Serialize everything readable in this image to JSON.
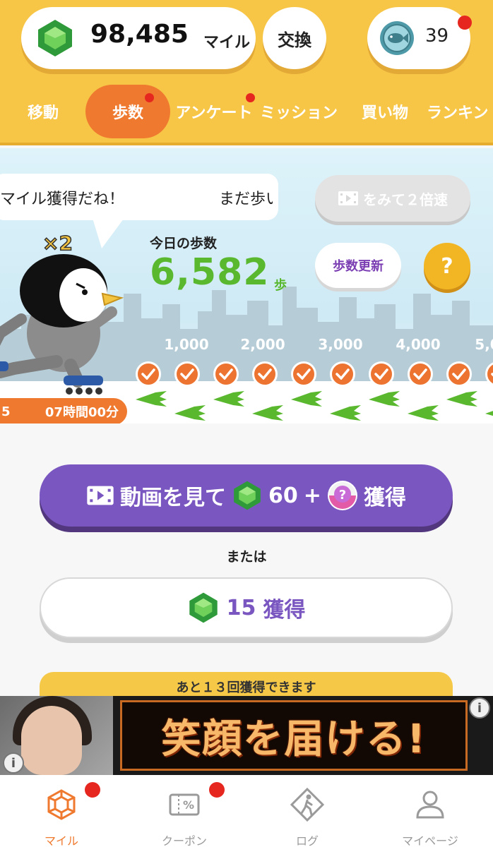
{
  "colors": {
    "header_bg": "#f8c647",
    "accent_orange": "#ef7a2f",
    "purple": "#7a56c0",
    "step_green": "#5ab82f",
    "badge_red": "#e6271f"
  },
  "header": {
    "miles_icon": "green-gem-icon",
    "miles_value": "98,485",
    "miles_unit": "マイル",
    "exchange_label": "交換",
    "fish_icon": "fish-coin-icon",
    "fish_count": "39"
  },
  "tabs": [
    {
      "label": "移動",
      "active": false,
      "badge": false
    },
    {
      "label": "歩数",
      "active": true,
      "badge": true
    },
    {
      "label": "アンケート",
      "active": false,
      "badge": true
    },
    {
      "label": "ミッション",
      "active": false,
      "badge": false
    },
    {
      "label": "買い物",
      "active": false,
      "badge": false
    },
    {
      "label": "ランキン",
      "active": false,
      "badge": false
    }
  ],
  "scene": {
    "speech_a": "マイル獲得だね！",
    "speech_b": "まだ歩い",
    "multiplier": "×2",
    "double_speed_label": "をみて２倍速",
    "double_speed_icon": "video-icon",
    "steps_label": "今日の歩数",
    "steps_value": "6,582",
    "steps_unit": "歩",
    "refresh_label": "歩数更新",
    "help_label": "?",
    "milestones": [
      "1,000",
      "2,000",
      "3,000",
      "4,000",
      "5,0"
    ],
    "timer": "07時間00分",
    "timer_prefix": "5"
  },
  "actions": {
    "video_button": {
      "icon": "video-icon",
      "text_a": "動画を見て",
      "gem_icon": "green-gem-icon",
      "amount": "60",
      "plus": "+",
      "bonus_icon": "mystery-capsule-icon",
      "text_b": "獲得"
    },
    "or_text": "または",
    "gem_button": {
      "icon": "green-gem-icon",
      "amount": "15",
      "text": "獲得"
    },
    "remaining": "あと１３回獲得できます"
  },
  "ad": {
    "headline": "笑顔を届ける!",
    "info_icon": "info-icon"
  },
  "nav": [
    {
      "label": "マイル",
      "icon": "gem-outline-icon",
      "active": true,
      "badge": true
    },
    {
      "label": "クーポン",
      "icon": "coupon-icon",
      "active": false,
      "badge": true
    },
    {
      "label": "ログ",
      "icon": "walking-log-icon",
      "active": false,
      "badge": false
    },
    {
      "label": "マイページ",
      "icon": "person-icon",
      "active": false,
      "badge": false
    }
  ]
}
